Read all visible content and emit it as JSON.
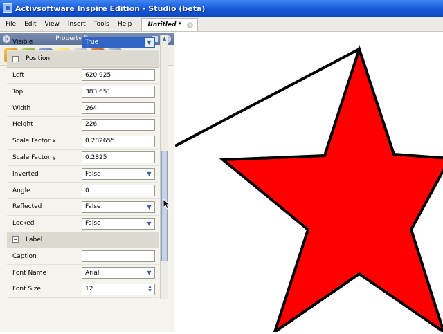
{
  "window": {
    "title": "Activsoftware Inspire Edition - Studio (beta)"
  },
  "menu": {
    "items": [
      "File",
      "Edit",
      "View",
      "Insert",
      "Tools",
      "Help"
    ]
  },
  "document_tab": {
    "label": "Untitled *",
    "close_symbol": "×"
  },
  "panel": {
    "title": "Property Browser",
    "toolbar_icons": [
      "pen-icon",
      "chart-icon",
      "house-icon",
      "note-icon",
      "page-icon",
      "stamp-icon",
      "link-icon"
    ]
  },
  "properties": {
    "visible": {
      "label": "Visible",
      "value": "True"
    },
    "position_section": "Position",
    "left": {
      "label": "Left",
      "value": "620.925"
    },
    "top": {
      "label": "Top",
      "value": "383.651"
    },
    "width": {
      "label": "Width",
      "value": "264"
    },
    "height": {
      "label": "Height",
      "value": "226"
    },
    "scale_x": {
      "label": "Scale Factor x",
      "value": "0.282655"
    },
    "scale_y": {
      "label": "Scale Factor y",
      "value": "0.2825"
    },
    "inverted": {
      "label": "Inverted",
      "value": "False"
    },
    "angle": {
      "label": "Angle",
      "value": "0"
    },
    "reflected": {
      "label": "Reflected",
      "value": "False"
    },
    "locked": {
      "label": "Locked",
      "value": "False"
    },
    "label_section": "Label",
    "caption": {
      "label": "Caption",
      "value": ""
    },
    "font_name": {
      "label": "Font Name",
      "value": "Arial"
    },
    "font_size": {
      "label": "Font Size",
      "value": "12"
    }
  },
  "colors": {
    "star_fill": "#ff0000",
    "star_stroke": "#000000",
    "title_bar": "#1759d8",
    "selection": "#2f63c4"
  }
}
